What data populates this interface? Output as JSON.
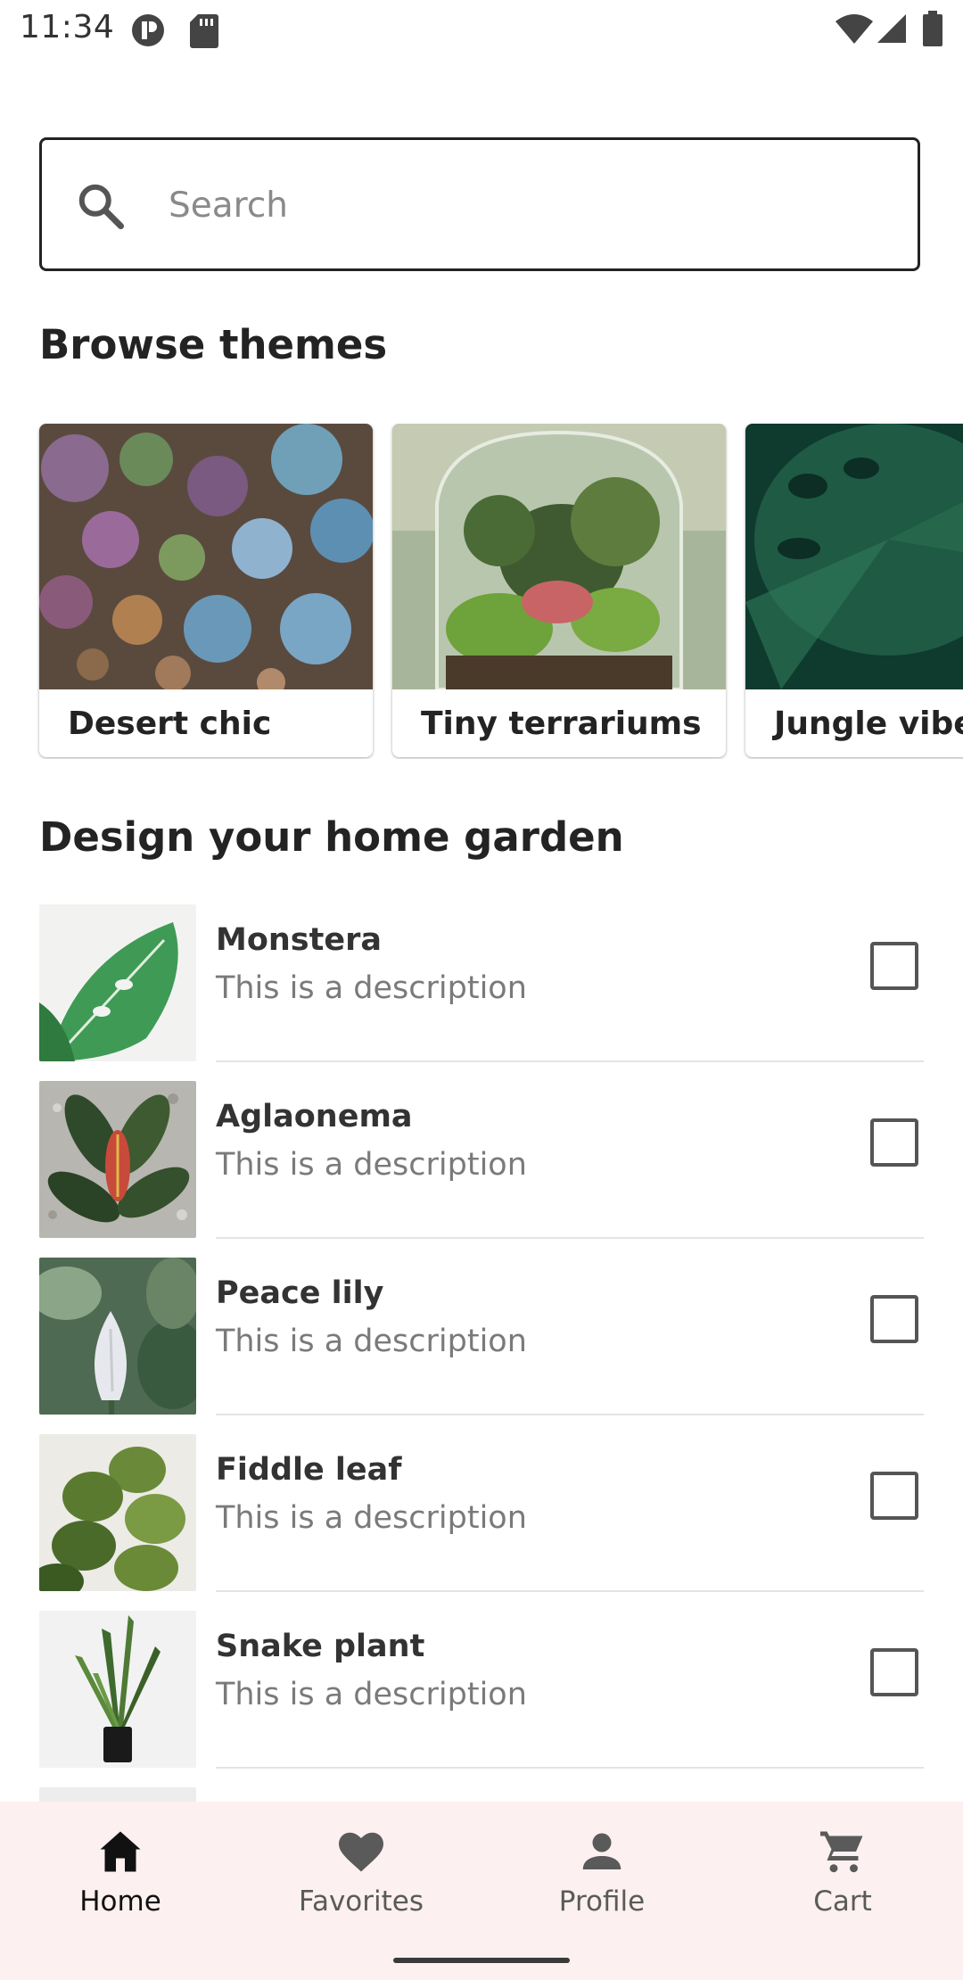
{
  "status_bar": {
    "time": "11:34"
  },
  "search": {
    "placeholder": "Search"
  },
  "browse": {
    "title": "Browse themes",
    "themes": [
      {
        "label": "Desert chic"
      },
      {
        "label": "Tiny terrariums"
      },
      {
        "label": "Jungle vibes"
      }
    ]
  },
  "garden": {
    "title": "Design your home garden",
    "items": [
      {
        "name": "Monstera",
        "description": "This is a description"
      },
      {
        "name": "Aglaonema",
        "description": "This is a description"
      },
      {
        "name": "Peace lily",
        "description": "This is a description"
      },
      {
        "name": "Fiddle leaf",
        "description": "This is a description"
      },
      {
        "name": "Snake plant",
        "description": "This is a description"
      }
    ]
  },
  "bottom_nav": {
    "items": [
      {
        "label": "Home",
        "icon": "home-icon",
        "active": true
      },
      {
        "label": "Favorites",
        "icon": "heart-icon",
        "active": false
      },
      {
        "label": "Profile",
        "icon": "person-icon",
        "active": false
      },
      {
        "label": "Cart",
        "icon": "cart-icon",
        "active": false
      }
    ]
  },
  "colors": {
    "nav_background": "#fdf0f0",
    "text_primary": "#232323",
    "text_secondary": "#7a7a7a"
  }
}
